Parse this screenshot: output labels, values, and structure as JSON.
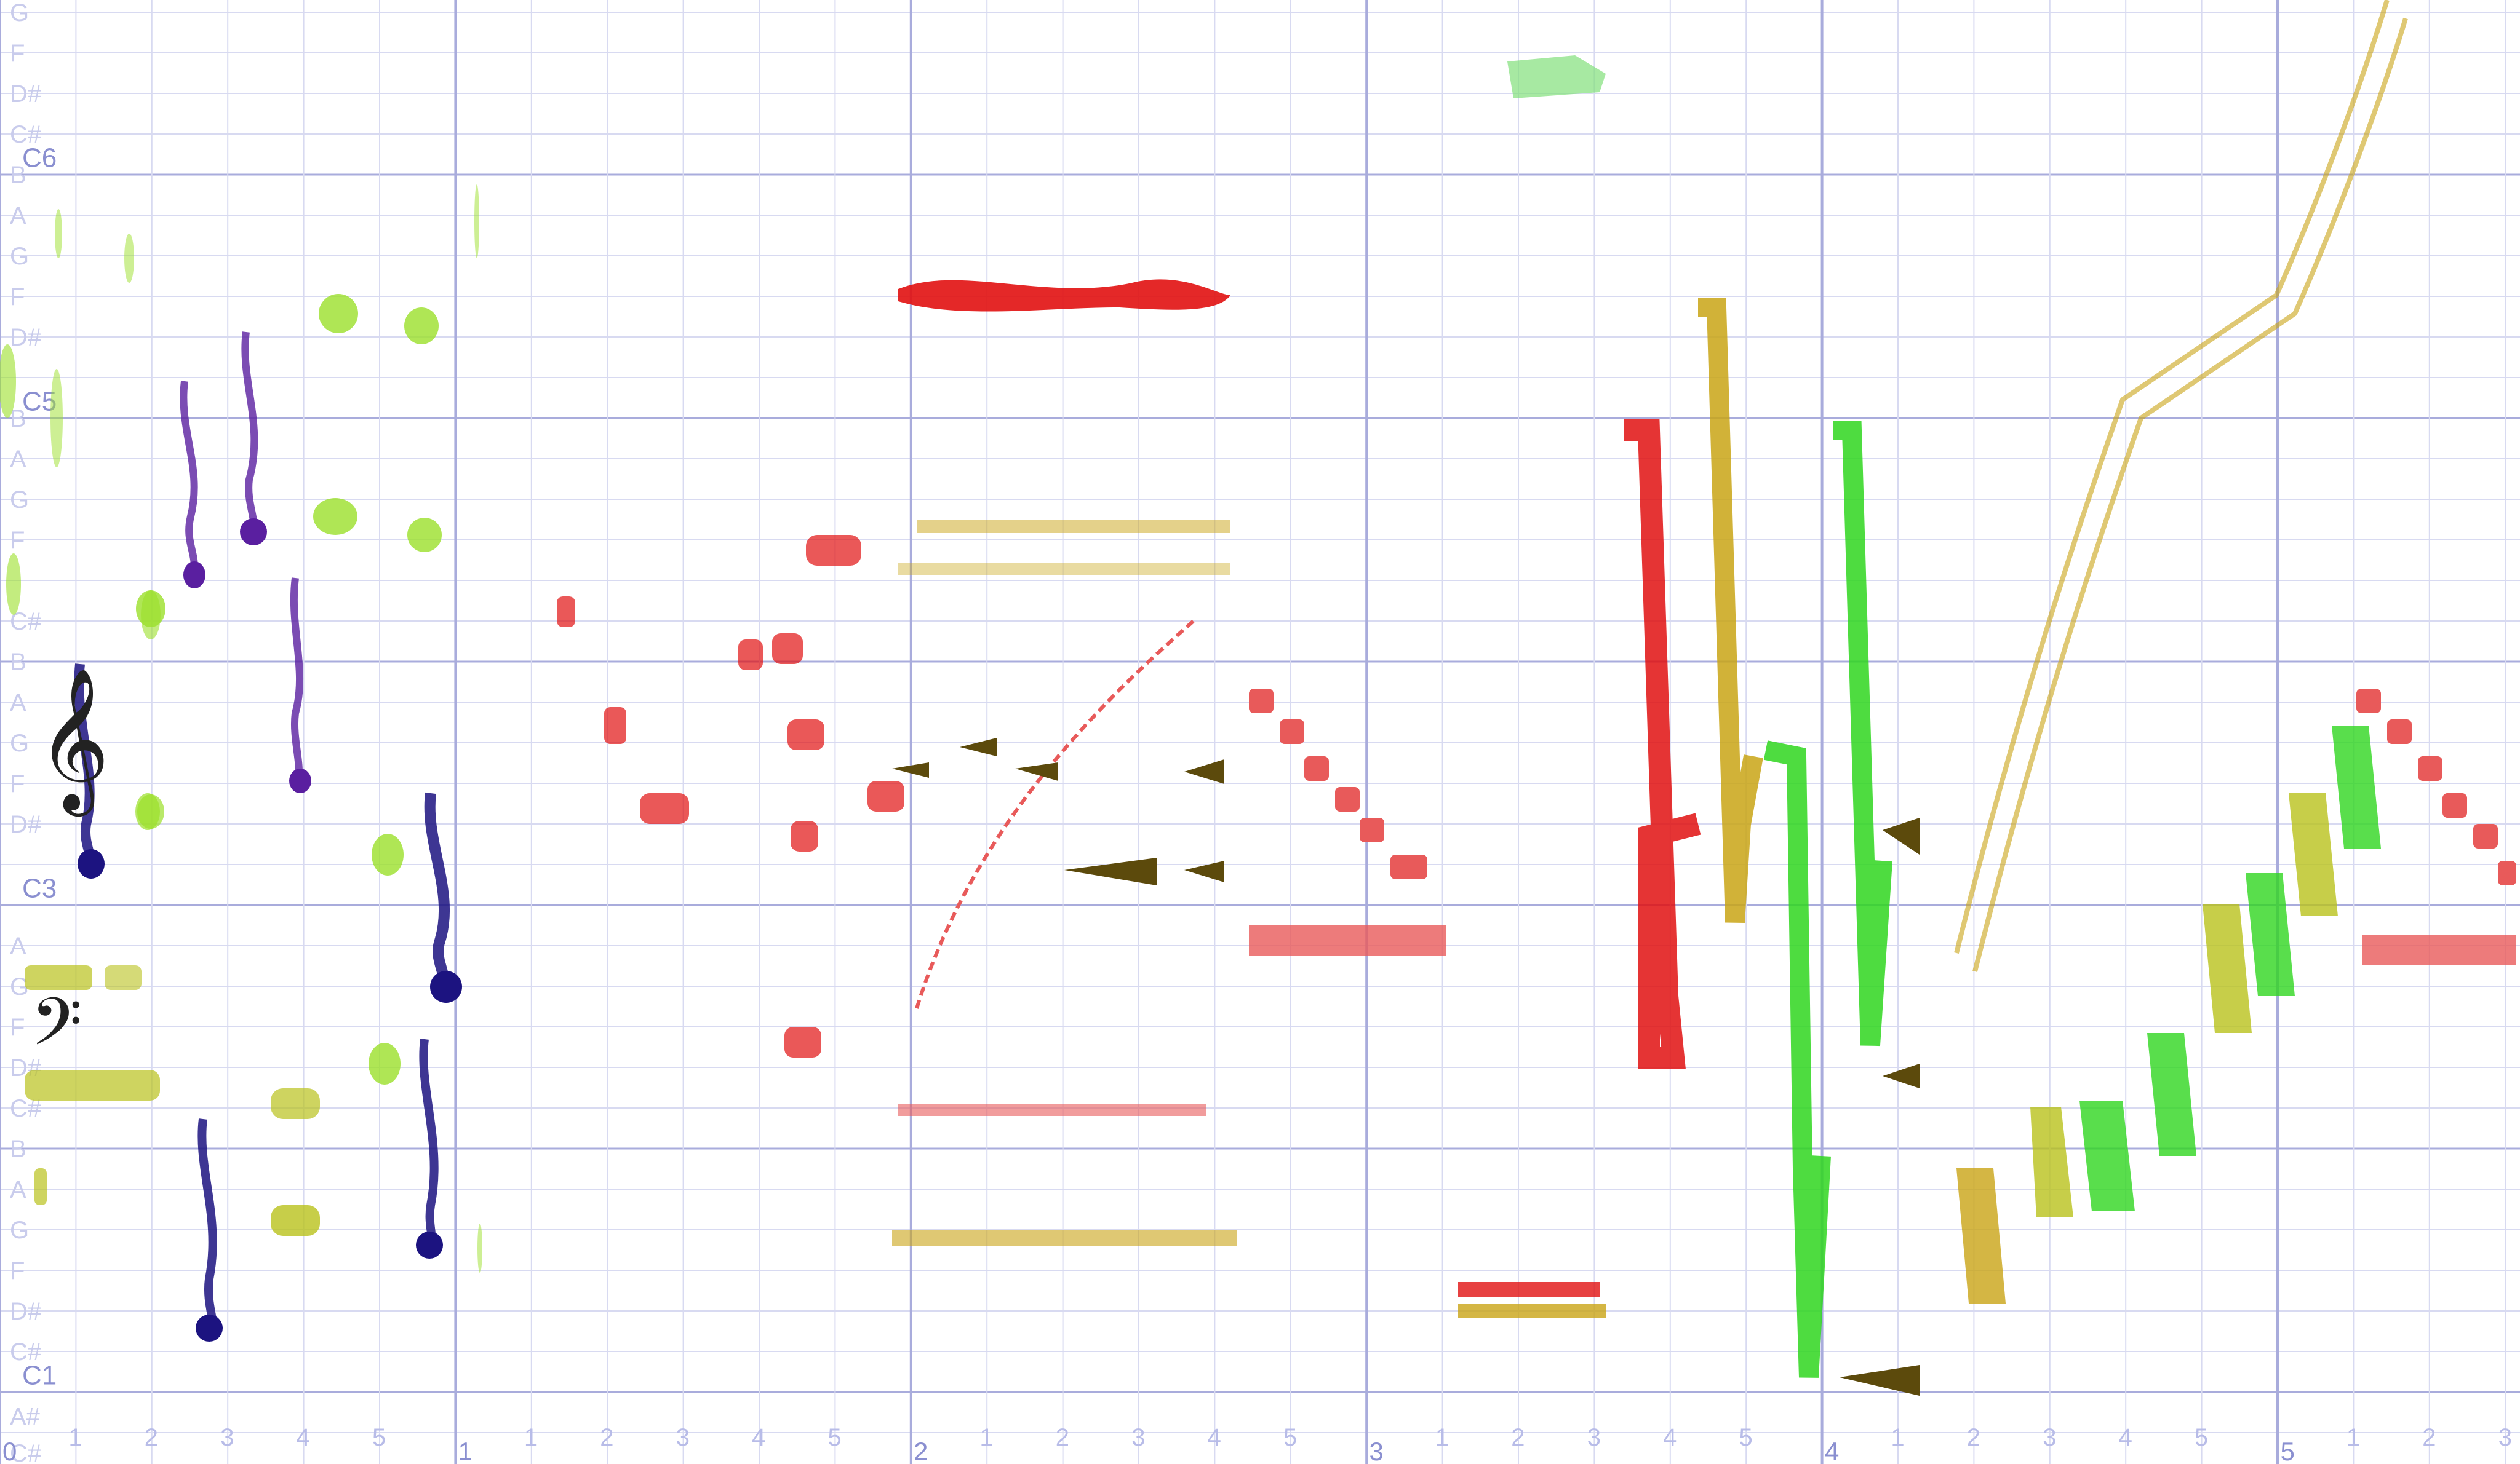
{
  "app": {
    "view": "piano-roll"
  },
  "clefs": {
    "treble": "𝄞",
    "bass": "𝄢"
  },
  "pitch_labels": [
    {
      "label": "G",
      "row": 0
    },
    {
      "label": "F",
      "row": 1
    },
    {
      "label": "D#",
      "row": 2
    },
    {
      "label": "C#",
      "row": 3
    },
    {
      "label": "C6",
      "row": 3.6,
      "octave": true
    },
    {
      "label": "B",
      "row": 4
    },
    {
      "label": "A",
      "row": 5
    },
    {
      "label": "G",
      "row": 6
    },
    {
      "label": "F",
      "row": 7
    },
    {
      "label": "D#",
      "row": 8
    },
    {
      "label": "C5",
      "row": 9.6,
      "octave": true
    },
    {
      "label": "B",
      "row": 10
    },
    {
      "label": "A",
      "row": 11
    },
    {
      "label": "G",
      "row": 12
    },
    {
      "label": "F",
      "row": 13
    },
    {
      "label": "C#",
      "row": 15
    },
    {
      "label": "B",
      "row": 16
    },
    {
      "label": "A",
      "row": 17
    },
    {
      "label": "G",
      "row": 18
    },
    {
      "label": "F",
      "row": 19
    },
    {
      "label": "D#",
      "row": 20
    },
    {
      "label": "C3",
      "row": 21.6,
      "octave": true
    },
    {
      "label": "A",
      "row": 23
    },
    {
      "label": "G",
      "row": 24
    },
    {
      "label": "F",
      "row": 25
    },
    {
      "label": "D#",
      "row": 26
    },
    {
      "label": "C#",
      "row": 27
    },
    {
      "label": "B",
      "row": 28
    },
    {
      "label": "A",
      "row": 29
    },
    {
      "label": "G",
      "row": 30
    },
    {
      "label": "F",
      "row": 31
    },
    {
      "label": "D#",
      "row": 32
    },
    {
      "label": "C#",
      "row": 33
    },
    {
      "label": "C1",
      "row": 33.6,
      "octave": true
    },
    {
      "label": "A#",
      "row": 34.6
    },
    {
      "label": "C#",
      "row": 35.5
    }
  ],
  "timeline": {
    "measures": [
      "0",
      "1",
      "2",
      "3",
      "4",
      "5"
    ],
    "beats": [
      "1",
      "2",
      "3",
      "4",
      "5"
    ],
    "extra_beats": [
      "1",
      "2",
      "3"
    ]
  },
  "colors": {
    "grid_major": "#a9acdc",
    "grid_minor": "#d8daf1",
    "background": "#ffffff",
    "lime": "#9be02a",
    "purple": "#5a1fa0",
    "navy": "#1c1380",
    "olive": "#b9c21c",
    "red": "#e11111",
    "salmon": "#e85a5a",
    "gold": "#c9a415",
    "green": "#2fd61f",
    "dark_olive": "#5c4a0c",
    "pale_green": "#82e07a"
  }
}
